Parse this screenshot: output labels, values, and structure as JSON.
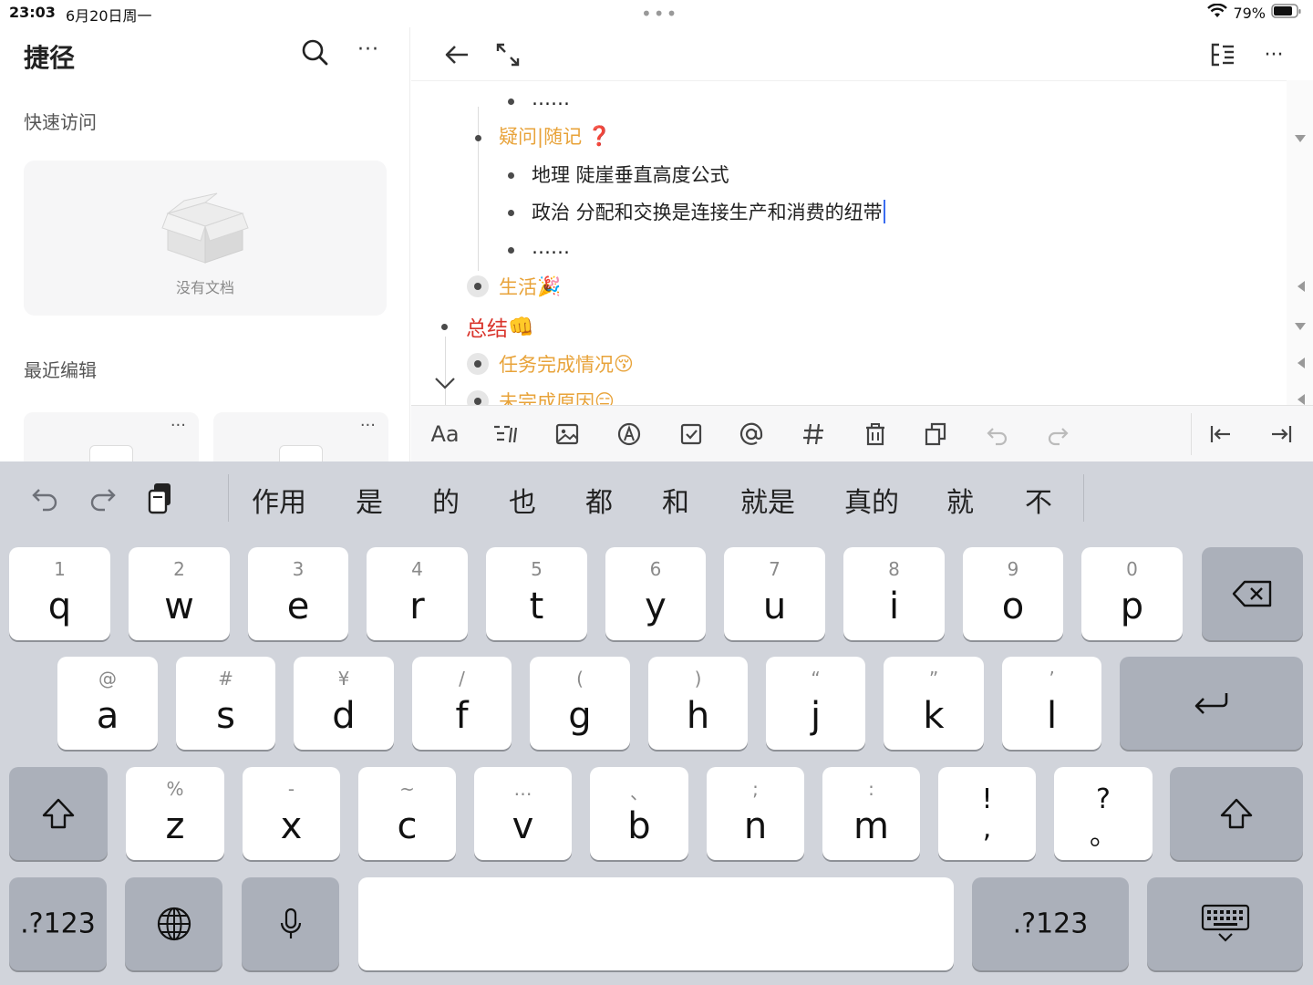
{
  "status": {
    "time": "23:03",
    "date": "6月20日周一",
    "battery": "79%",
    "multitask": "•••"
  },
  "sidebar": {
    "title": "捷径",
    "more": "···",
    "quick_access_label": "快速访问",
    "empty_text": "没有文档",
    "recent_label": "最近编辑",
    "recent_more": "···"
  },
  "editor": {
    "lines": [
      {
        "text": "……"
      },
      {
        "text": "疑问|随记",
        "emoji": "❓"
      },
      {
        "text": "地理  陡崖垂直高度公式"
      },
      {
        "text": "政治  分配和交换是连接生产和消费的纽带"
      },
      {
        "text": "……"
      },
      {
        "text": "生活",
        "emoji": "🎉"
      },
      {
        "text": "总结",
        "emoji": "👊"
      },
      {
        "text": "任务完成情况",
        "emoji": "😚"
      },
      {
        "text": "未完成原因",
        "emoji": "😑"
      }
    ]
  },
  "format_bar": {
    "text_style": "Aa"
  },
  "keyboard": {
    "candidates": [
      "作用",
      "是",
      "的",
      "也",
      "都",
      "和",
      "就是",
      "真的",
      "就",
      "不"
    ],
    "row1": [
      {
        "hint": "1",
        "key": "q"
      },
      {
        "hint": "2",
        "key": "w"
      },
      {
        "hint": "3",
        "key": "e"
      },
      {
        "hint": "4",
        "key": "r"
      },
      {
        "hint": "5",
        "key": "t"
      },
      {
        "hint": "6",
        "key": "y"
      },
      {
        "hint": "7",
        "key": "u"
      },
      {
        "hint": "8",
        "key": "i"
      },
      {
        "hint": "9",
        "key": "o"
      },
      {
        "hint": "0",
        "key": "p"
      }
    ],
    "row2": [
      {
        "hint": "@",
        "key": "a"
      },
      {
        "hint": "#",
        "key": "s"
      },
      {
        "hint": "¥",
        "key": "d"
      },
      {
        "hint": "/",
        "key": "f"
      },
      {
        "hint": "(",
        "key": "g"
      },
      {
        "hint": ")",
        "key": "h"
      },
      {
        "hint": "“",
        "key": "j"
      },
      {
        "hint": "”",
        "key": "k"
      },
      {
        "hint": "’",
        "key": "l"
      }
    ],
    "row3": [
      {
        "hint": "%",
        "key": "z"
      },
      {
        "hint": "-",
        "key": "x"
      },
      {
        "hint": "~",
        "key": "c"
      },
      {
        "hint": "…",
        "key": "v"
      },
      {
        "hint": "、",
        "key": "b"
      },
      {
        "hint": ";",
        "key": "n"
      },
      {
        "hint": ":",
        "key": "m"
      }
    ],
    "punct1": {
      "top": "!",
      "bottom": ","
    },
    "punct2": {
      "top": "?",
      "bottom": "。"
    },
    "numbers_label": ".?123"
  }
}
